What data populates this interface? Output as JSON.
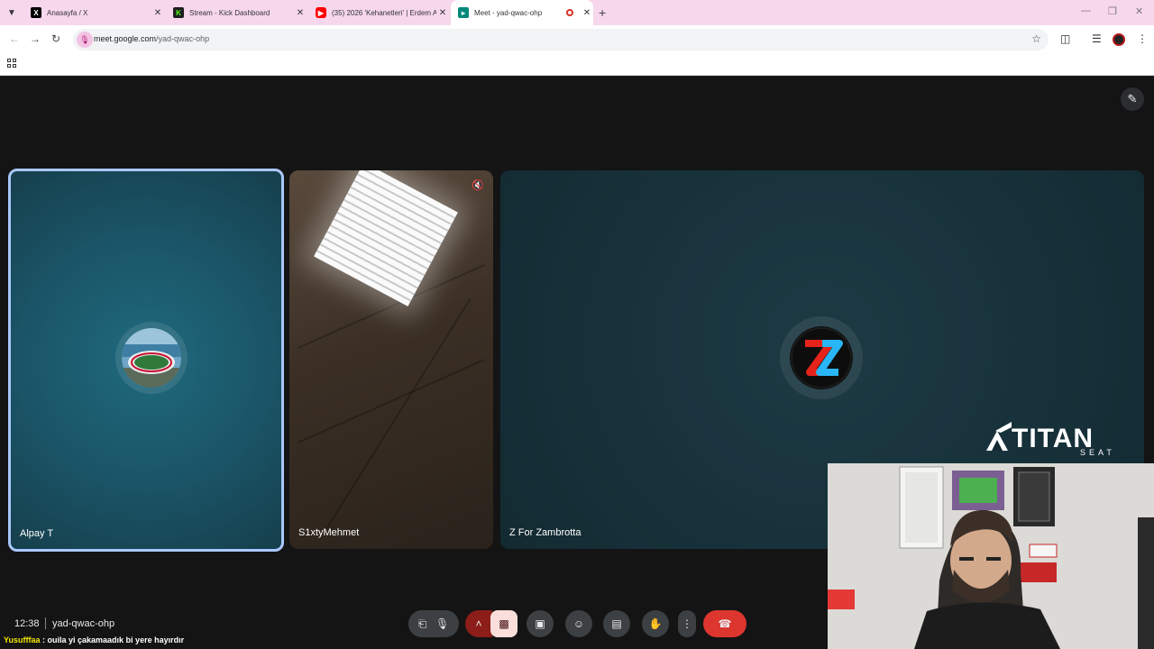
{
  "browser": {
    "tabs": [
      {
        "title": "Anasayfa / X",
        "favicon": "x-logo-icon",
        "color": "#000000",
        "active": false
      },
      {
        "title": "Stream - Kick Dashboard",
        "favicon": "kick-logo-icon",
        "color": "#53fc18",
        "active": false
      },
      {
        "title": "(35) 2026 'Kehanetleri' | Erdem A",
        "favicon": "youtube-logo-icon",
        "color": "#ff0000",
        "active": false
      },
      {
        "title": "Meet - yad-qwac-ohp",
        "favicon": "google-meet-icon",
        "color": "#00897b",
        "active": true
      }
    ],
    "address": {
      "host": "meet.google.com",
      "path": "/yad-qwac-ohp"
    },
    "accent_color": "#f7d7ec"
  },
  "meet": {
    "participants": [
      {
        "name": "Alpay T",
        "avatar": "stadium-photo",
        "speaking": true
      },
      {
        "name": "S1xtyMehmet",
        "avatar": "camera-feed-ceiling-light",
        "muted": true
      },
      {
        "name": "Z For Zambrotta",
        "avatar": "z-logo"
      }
    ],
    "clock": "12:38",
    "meeting_code": "yad-qwac-ohp",
    "controls": [
      "audio-settings",
      "microphone",
      "camera-options",
      "camera-off",
      "present-screen",
      "reactions",
      "captions",
      "raise-hand",
      "more-options",
      "leave-call"
    ]
  },
  "overlay": {
    "brand": {
      "name": "TITAN",
      "sub": "SEAT"
    },
    "chat": {
      "user": "Yusufffaa",
      "message": " : ouila yi çakamaadık bi yere hayırdır"
    }
  }
}
